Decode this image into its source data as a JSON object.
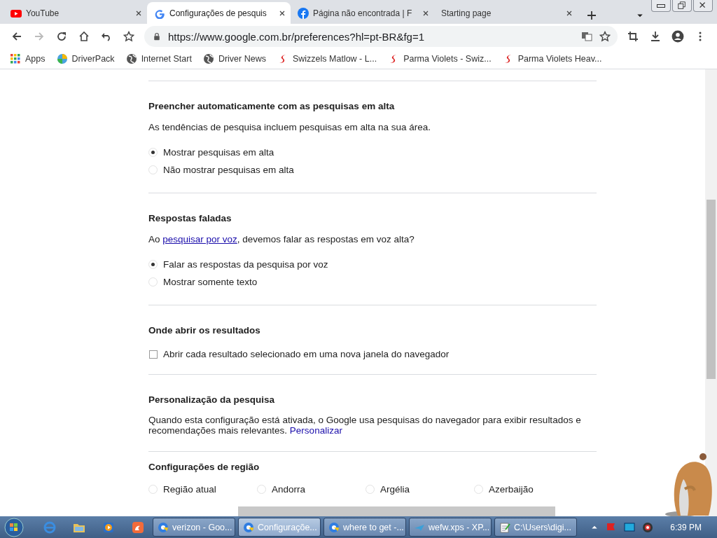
{
  "tabs": [
    {
      "title": "YouTube",
      "selected": false
    },
    {
      "title": "Configurações de pesquis",
      "selected": true
    },
    {
      "title": "Página não encontrada | F",
      "selected": false
    },
    {
      "title": "Starting page",
      "selected": false
    }
  ],
  "address": {
    "url": "https://www.google.com.br/preferences?hl=pt-BR&fg=1"
  },
  "bookmarks": [
    {
      "label": "Apps"
    },
    {
      "label": "DriverPack"
    },
    {
      "label": "Internet Start"
    },
    {
      "label": "Driver News"
    },
    {
      "label": "Swizzels Matlow - L..."
    },
    {
      "label": "Parma Violets - Swiz..."
    },
    {
      "label": "Parma Violets Heav..."
    }
  ],
  "sections": [
    {
      "kind": "radios",
      "title": "Preencher automaticamente com as pesquisas em alta",
      "description": "As tendências de pesquisa incluem pesquisas em alta na sua área.",
      "options": [
        {
          "label": "Mostrar pesquisas em alta",
          "selected": true
        },
        {
          "label": "Não mostrar pesquisas em alta",
          "selected": false
        }
      ]
    },
    {
      "kind": "radios",
      "title": "Respostas faladas",
      "description_before": "Ao ",
      "link": "pesquisar por voz",
      "description_after": ", devemos falar as respostas em voz alta?",
      "options": [
        {
          "label": "Falar as respostas da pesquisa por voz",
          "selected": true
        },
        {
          "label": "Mostrar somente texto",
          "selected": false
        }
      ]
    },
    {
      "kind": "checkbox",
      "title": "Onde abrir os resultados",
      "option": {
        "label": "Abrir cada resultado selecionado em uma nova janela do navegador",
        "checked": false
      }
    },
    {
      "kind": "text",
      "title": "Personalização da pesquisa",
      "description_before": "Quando esta configuração está ativada, o Google usa pesquisas do navegador para exibir resultados e recomendações mais relevantes. ",
      "link": "Personalizar"
    },
    {
      "kind": "regions",
      "title": "Configurações de região",
      "options": [
        {
          "label": "Região atual",
          "selected": false
        },
        {
          "label": "Andorra",
          "selected": false
        },
        {
          "label": "Argélia",
          "selected": false
        },
        {
          "label": "Azerbaijão",
          "selected": false
        }
      ]
    }
  ],
  "taskbar": {
    "tasks": [
      {
        "label": "verizon - Goo...",
        "selected": false
      },
      {
        "label": "Configuraçõe...",
        "selected": true
      },
      {
        "label": "where to get -...",
        "selected": false
      },
      {
        "label": "wefw.xps - XP...",
        "selected": false
      },
      {
        "label": "C:\\Users\\digi...",
        "selected": false
      }
    ],
    "clock": "6:39 PM"
  }
}
